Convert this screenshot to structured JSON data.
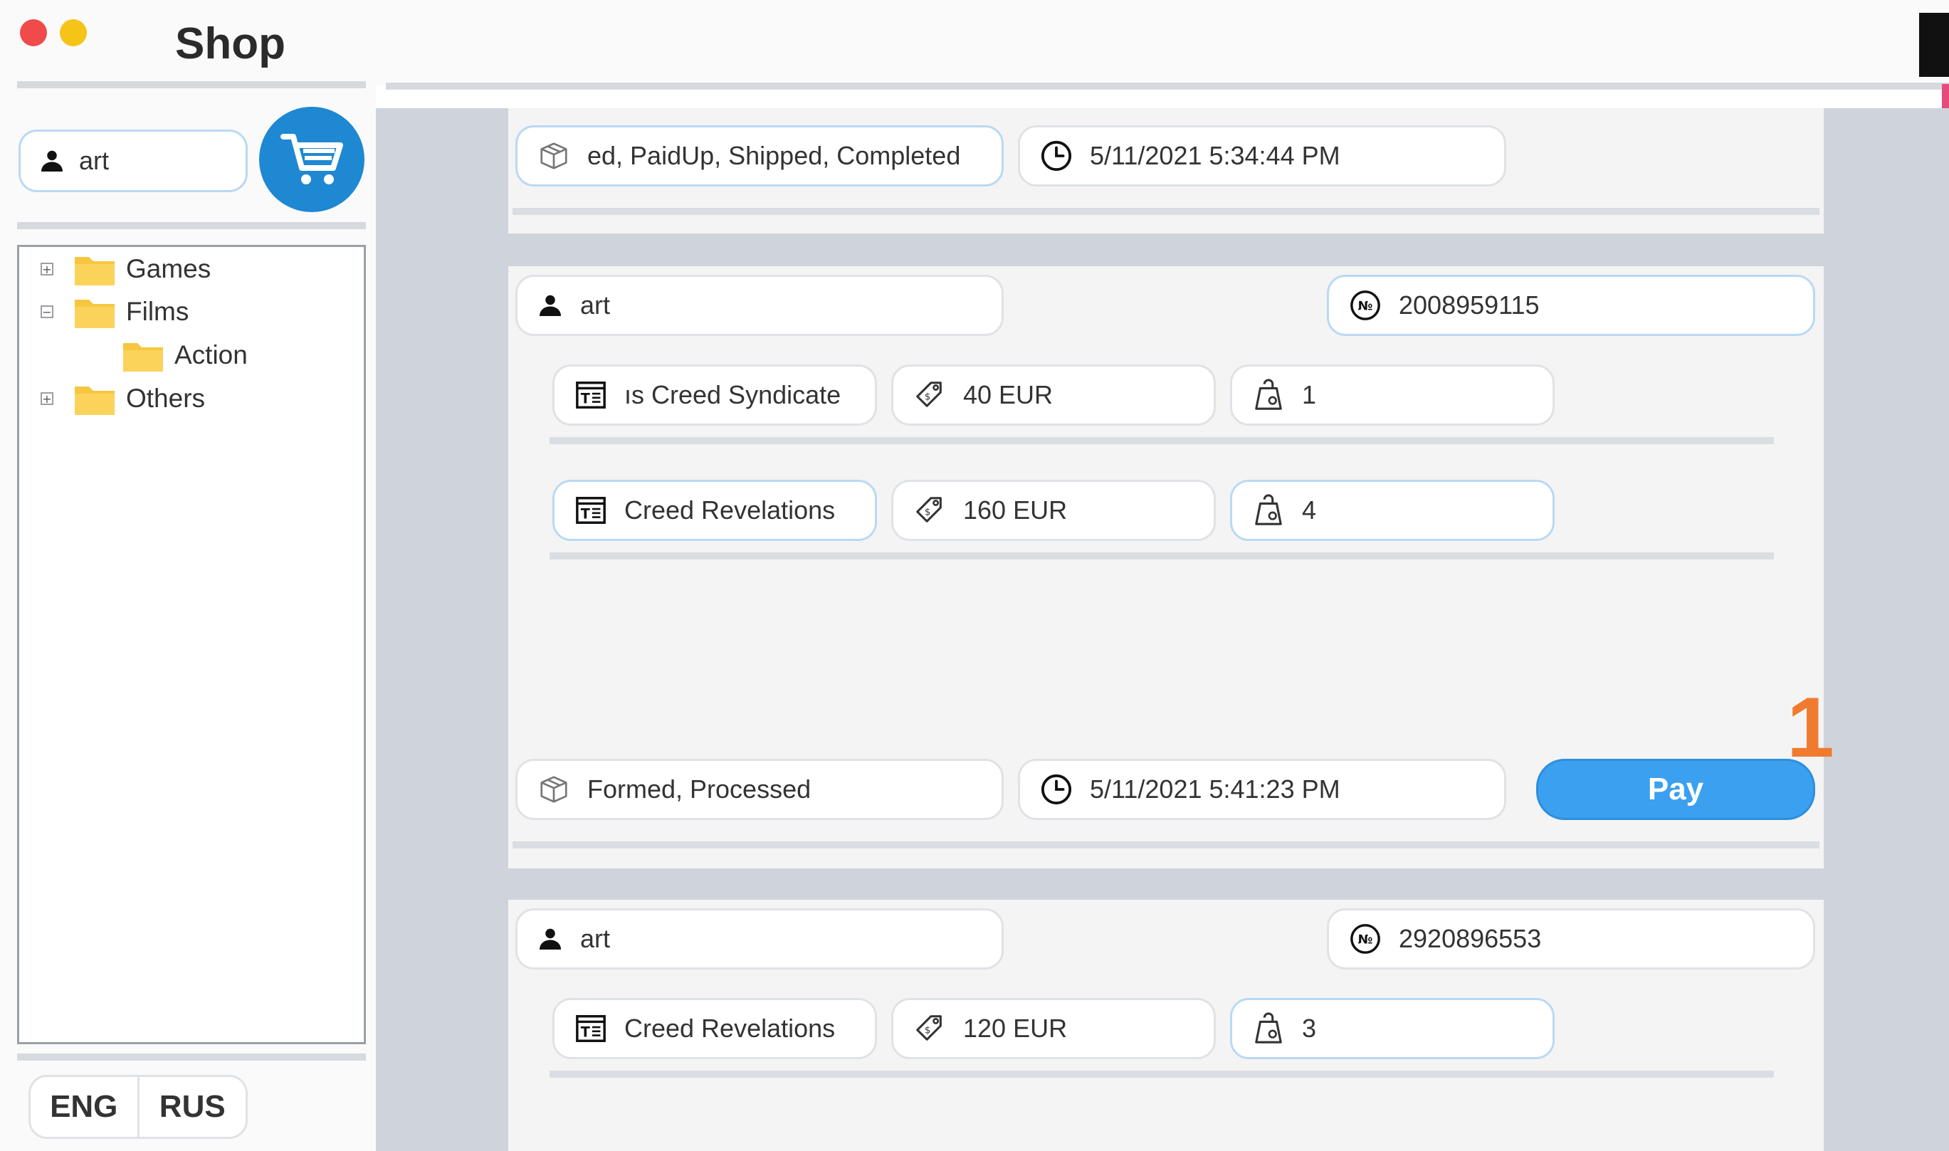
{
  "window": {
    "title": "Shop"
  },
  "sidebar": {
    "user_name": "art",
    "tree": [
      {
        "label": "Games",
        "toggle": "+"
      },
      {
        "label": "Films",
        "toggle": "−"
      },
      {
        "label": "Action",
        "toggle": ""
      },
      {
        "label": "Others",
        "toggle": "+"
      }
    ],
    "languages": [
      "ENG",
      "RUS"
    ]
  },
  "orders": [
    {
      "status": "ed, PaidUp, Shipped, Completed",
      "datetime": "5/11/2021 5:34:44 PM"
    },
    {
      "user": "art",
      "number": "2008959115",
      "items": [
        {
          "name": "ıs Creed Syndicate",
          "price": "40 EUR",
          "quantity": "1"
        },
        {
          "name": "Creed Revelations",
          "price": "160 EUR",
          "quantity": "4"
        }
      ],
      "status": "Formed, Processed",
      "datetime": "5/11/2021 5:41:23 PM",
      "pay_label": "Pay"
    },
    {
      "user": "art",
      "number": "2920896553",
      "items": [
        {
          "name": "Creed Revelations",
          "price": "120 EUR",
          "quantity": "3"
        }
      ]
    }
  ],
  "annotation": "1",
  "icons": {
    "user": "user-icon",
    "cart": "cart-icon",
    "folder": "folder-icon",
    "status": "box-icon",
    "time": "clock-icon",
    "number": "number-icon",
    "product": "product-icon",
    "price": "price-tag-icon",
    "quantity": "weight-icon"
  },
  "colors": {
    "accent": "#1e88d2",
    "pay": "#3ba0ef",
    "annotation": "#f07b2e",
    "field_border_focus": "#b9d9f4",
    "folder": "#f7c640"
  }
}
